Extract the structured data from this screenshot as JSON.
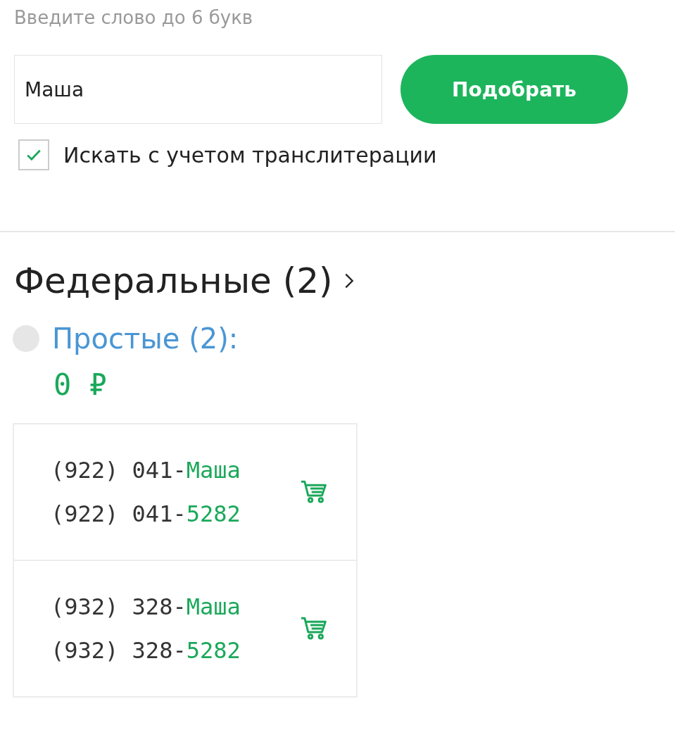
{
  "search": {
    "hint": "Введите слово до 6 букв",
    "value": "Маша",
    "button": "Подобрать"
  },
  "transliteration": {
    "label": "Искать с учетом транслитерации",
    "checked": true
  },
  "section": {
    "title": "Федеральные (2)"
  },
  "category": {
    "label": "Простые (2):",
    "selected": false,
    "price": "0 ₽"
  },
  "numbers": [
    {
      "lines": [
        {
          "prefix": "(922) 041-",
          "suffix": "Маша"
        },
        {
          "prefix": "(922) 041-",
          "suffix": "5282"
        }
      ]
    },
    {
      "lines": [
        {
          "prefix": "(932) 328-",
          "suffix": "Маша"
        },
        {
          "prefix": "(932) 328-",
          "suffix": "5282"
        }
      ]
    }
  ]
}
